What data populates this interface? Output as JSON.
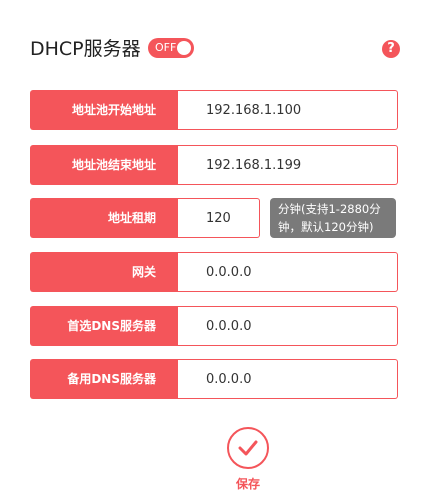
{
  "header": {
    "title": "DHCP服务器",
    "toggle_label": "OFF",
    "help_glyph": "?"
  },
  "fields": [
    {
      "label": "地址池开始地址",
      "value": "192.168.1.100"
    },
    {
      "label": "地址池结束地址",
      "value": "192.168.1.199"
    },
    {
      "label": "地址租期",
      "value": "120",
      "hint": "分钟(支持1-2880分钟，默认120分钟)"
    },
    {
      "label": "网关",
      "value": "0.0.0.0"
    },
    {
      "label": "首选DNS服务器",
      "value": "0.0.0.0"
    },
    {
      "label": "备用DNS服务器",
      "value": "0.0.0.0"
    }
  ],
  "save": {
    "label": "保存"
  },
  "colors": {
    "accent": "#f4555a",
    "hint_bg": "#7a7a7a"
  },
  "icons": {
    "help": "help-icon",
    "save": "check-icon"
  }
}
